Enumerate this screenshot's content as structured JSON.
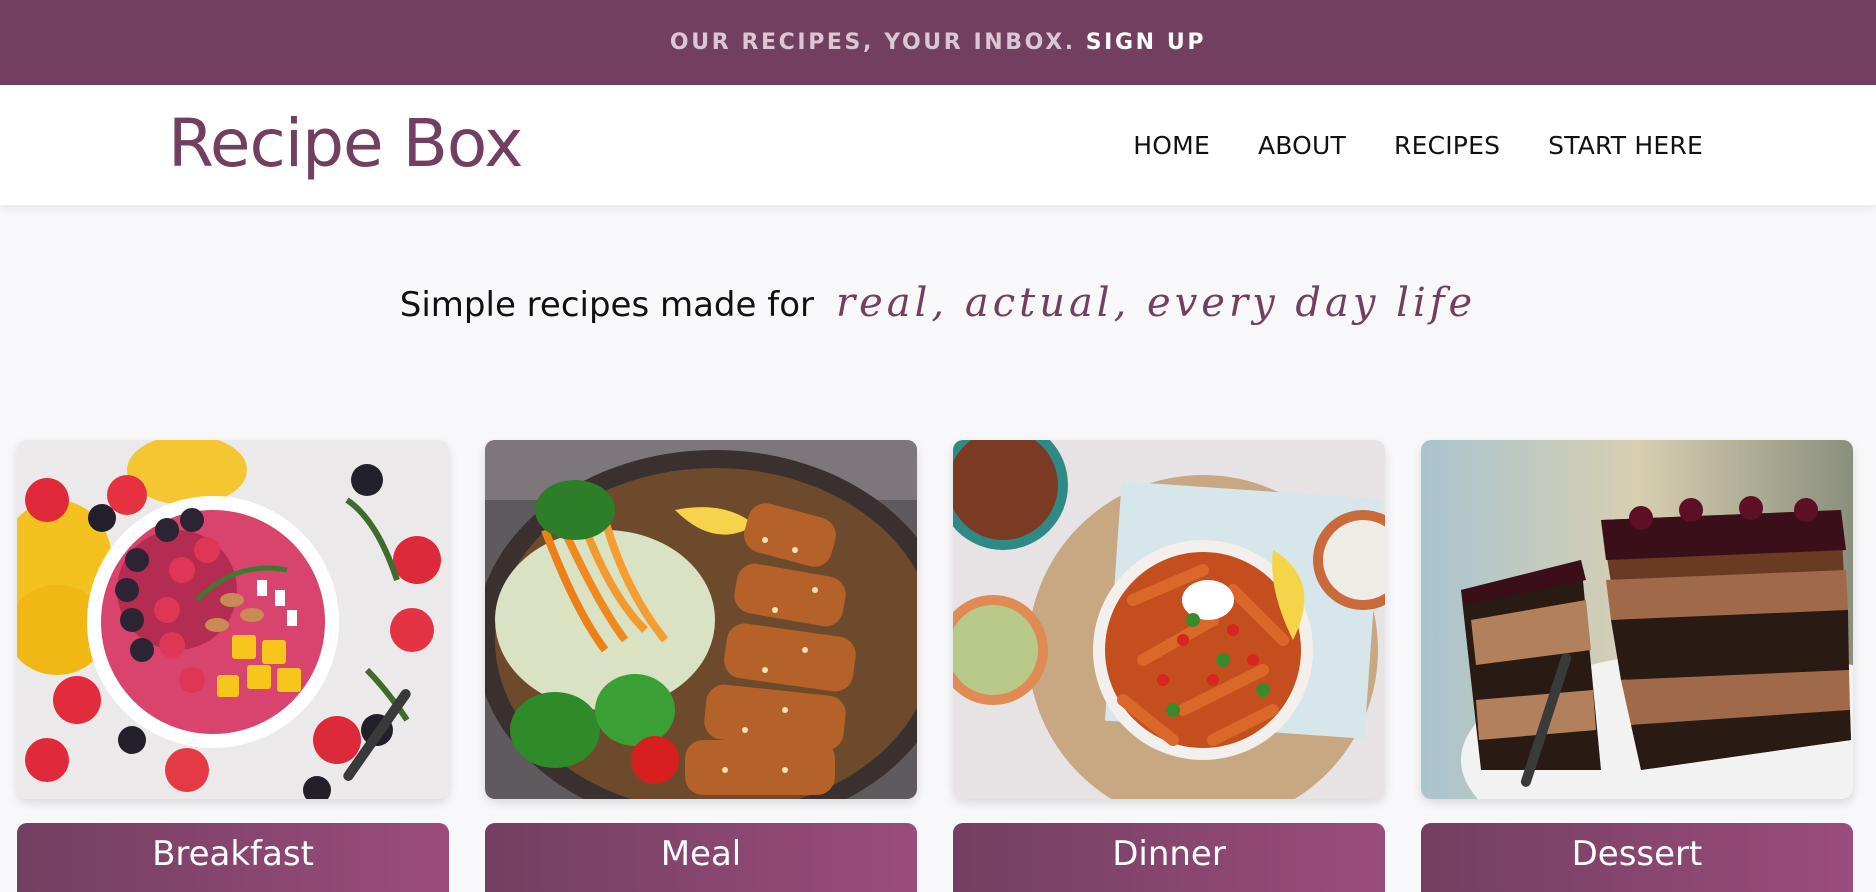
{
  "promo": {
    "text": "OUR RECIPES, YOUR INBOX.",
    "link": "SIGN UP"
  },
  "header": {
    "logo": "Recipe Box",
    "nav": [
      {
        "label": "HOME"
      },
      {
        "label": "ABOUT"
      },
      {
        "label": "RECIPES"
      },
      {
        "label": "START HERE"
      }
    ]
  },
  "tagline": {
    "plain": "Simple recipes made for",
    "script": "real, actual, every day life"
  },
  "categories": [
    {
      "label": "Breakfast",
      "image": "smoothie-bowl-with-fruit-photo"
    },
    {
      "label": "Meal",
      "image": "chicken-with-salad-photo"
    },
    {
      "label": "Dinner",
      "image": "sweet-potato-fries-photo"
    },
    {
      "label": "Dessert",
      "image": "chocolate-cake-photo"
    }
  ],
  "colors": {
    "brand": "#733f61",
    "brand_light": "#9a4c7d",
    "background": "#f8f8fa"
  }
}
